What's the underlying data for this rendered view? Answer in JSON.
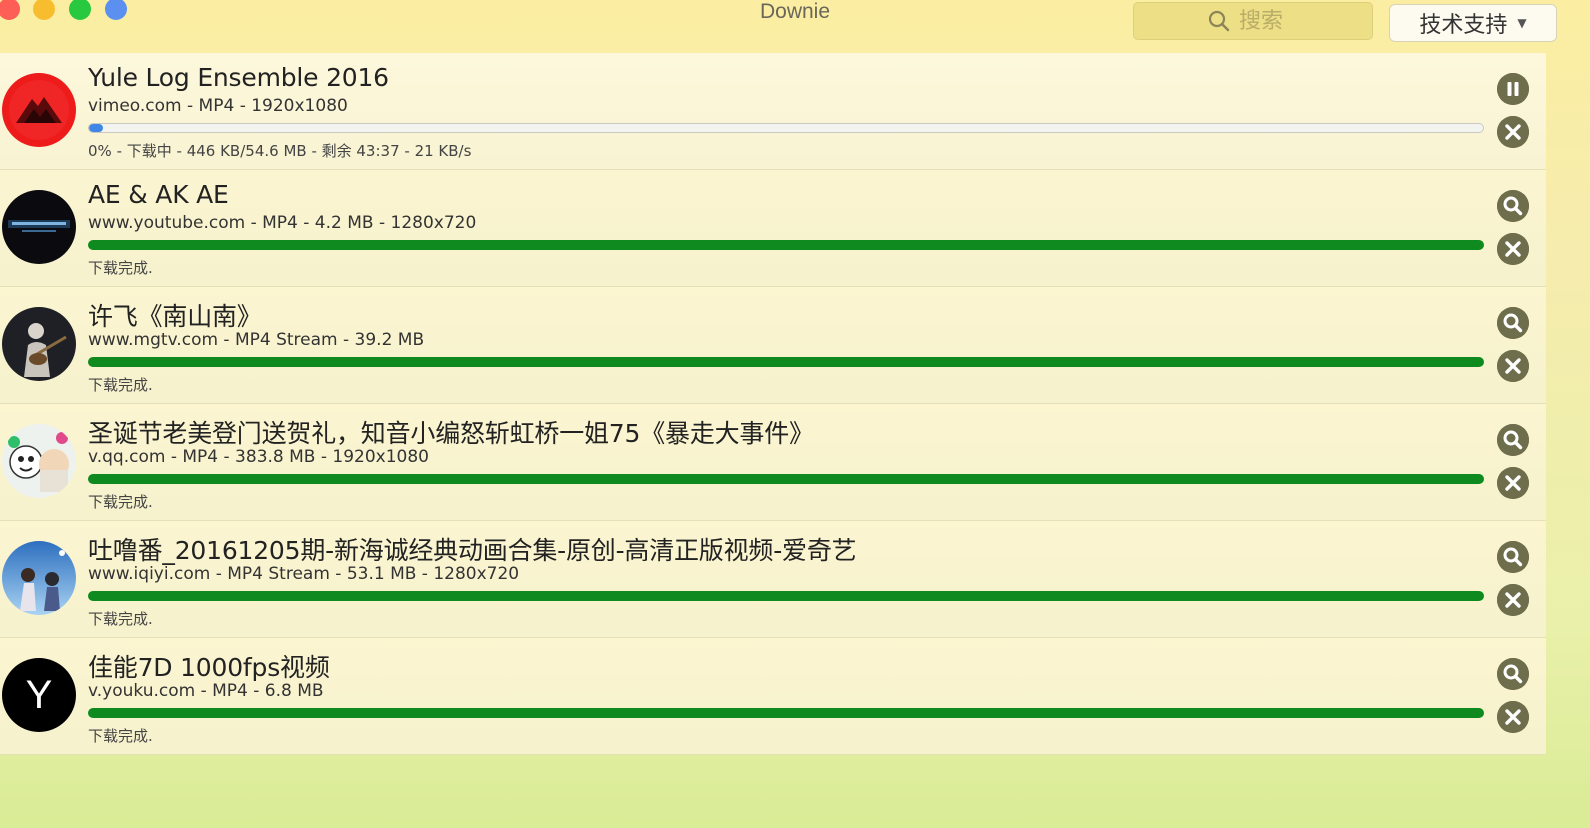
{
  "window": {
    "title": "Downie",
    "search_placeholder": "搜索",
    "support_label": "技术支持"
  },
  "colors": {
    "progress_done": "#0e8a1e",
    "progress_active": "#3f87e6",
    "control_buttons": "#6f6e4c"
  },
  "downloads": [
    {
      "title": "Yule Log Ensemble 2016",
      "meta": "vimeo.com - MP4 - 1920x1080",
      "status": "0% - 下载中 - 446 KB/54.6 MB - 剩余 43:37 - 21 KB/s",
      "progress_percent": 0,
      "state": "downloading",
      "thumb_icon": "red-volcano-thumbnail",
      "action_icon": "pause-icon"
    },
    {
      "title": "AE & AK AE",
      "meta": "www.youtube.com - MP4 - 4.2 MB - 1280x720",
      "status": "下载完成.",
      "progress_percent": 100,
      "state": "complete",
      "thumb_icon": "dark-video-thumbnail",
      "action_icon": "magnifier-icon"
    },
    {
      "title": "许飞《南山南》",
      "meta": "www.mgtv.com - MP4 Stream - 39.2 MB",
      "status": "下载完成.",
      "progress_percent": 100,
      "state": "complete",
      "thumb_icon": "guitarist-thumbnail",
      "action_icon": "magnifier-icon"
    },
    {
      "title": "圣诞节老美登门送贺礼，知音小编怒斩虹桥一姐75《暴走大事件》",
      "meta": "v.qq.com - MP4 - 383.8 MB - 1920x1080",
      "status": "下载完成.",
      "progress_percent": 100,
      "state": "complete",
      "thumb_icon": "cartoon-faces-thumbnail",
      "action_icon": "magnifier-icon"
    },
    {
      "title": "吐噜番_20161205期-新海诚经典动画合集-原创-高清正版视频-爱奇艺",
      "meta": "www.iqiyi.com - MP4 Stream - 53.1 MB - 1280x720",
      "status": "下载完成.",
      "progress_percent": 100,
      "state": "complete",
      "thumb_icon": "anime-sky-thumbnail",
      "action_icon": "magnifier-icon"
    },
    {
      "title": "佳能7D 1000fps视频",
      "meta": "v.youku.com - MP4 - 6.8 MB",
      "status": "下载完成.",
      "progress_percent": 100,
      "state": "complete",
      "thumb_icon": "youku-y-thumbnail",
      "thumb_letter": "Y",
      "action_icon": "magnifier-icon"
    }
  ]
}
